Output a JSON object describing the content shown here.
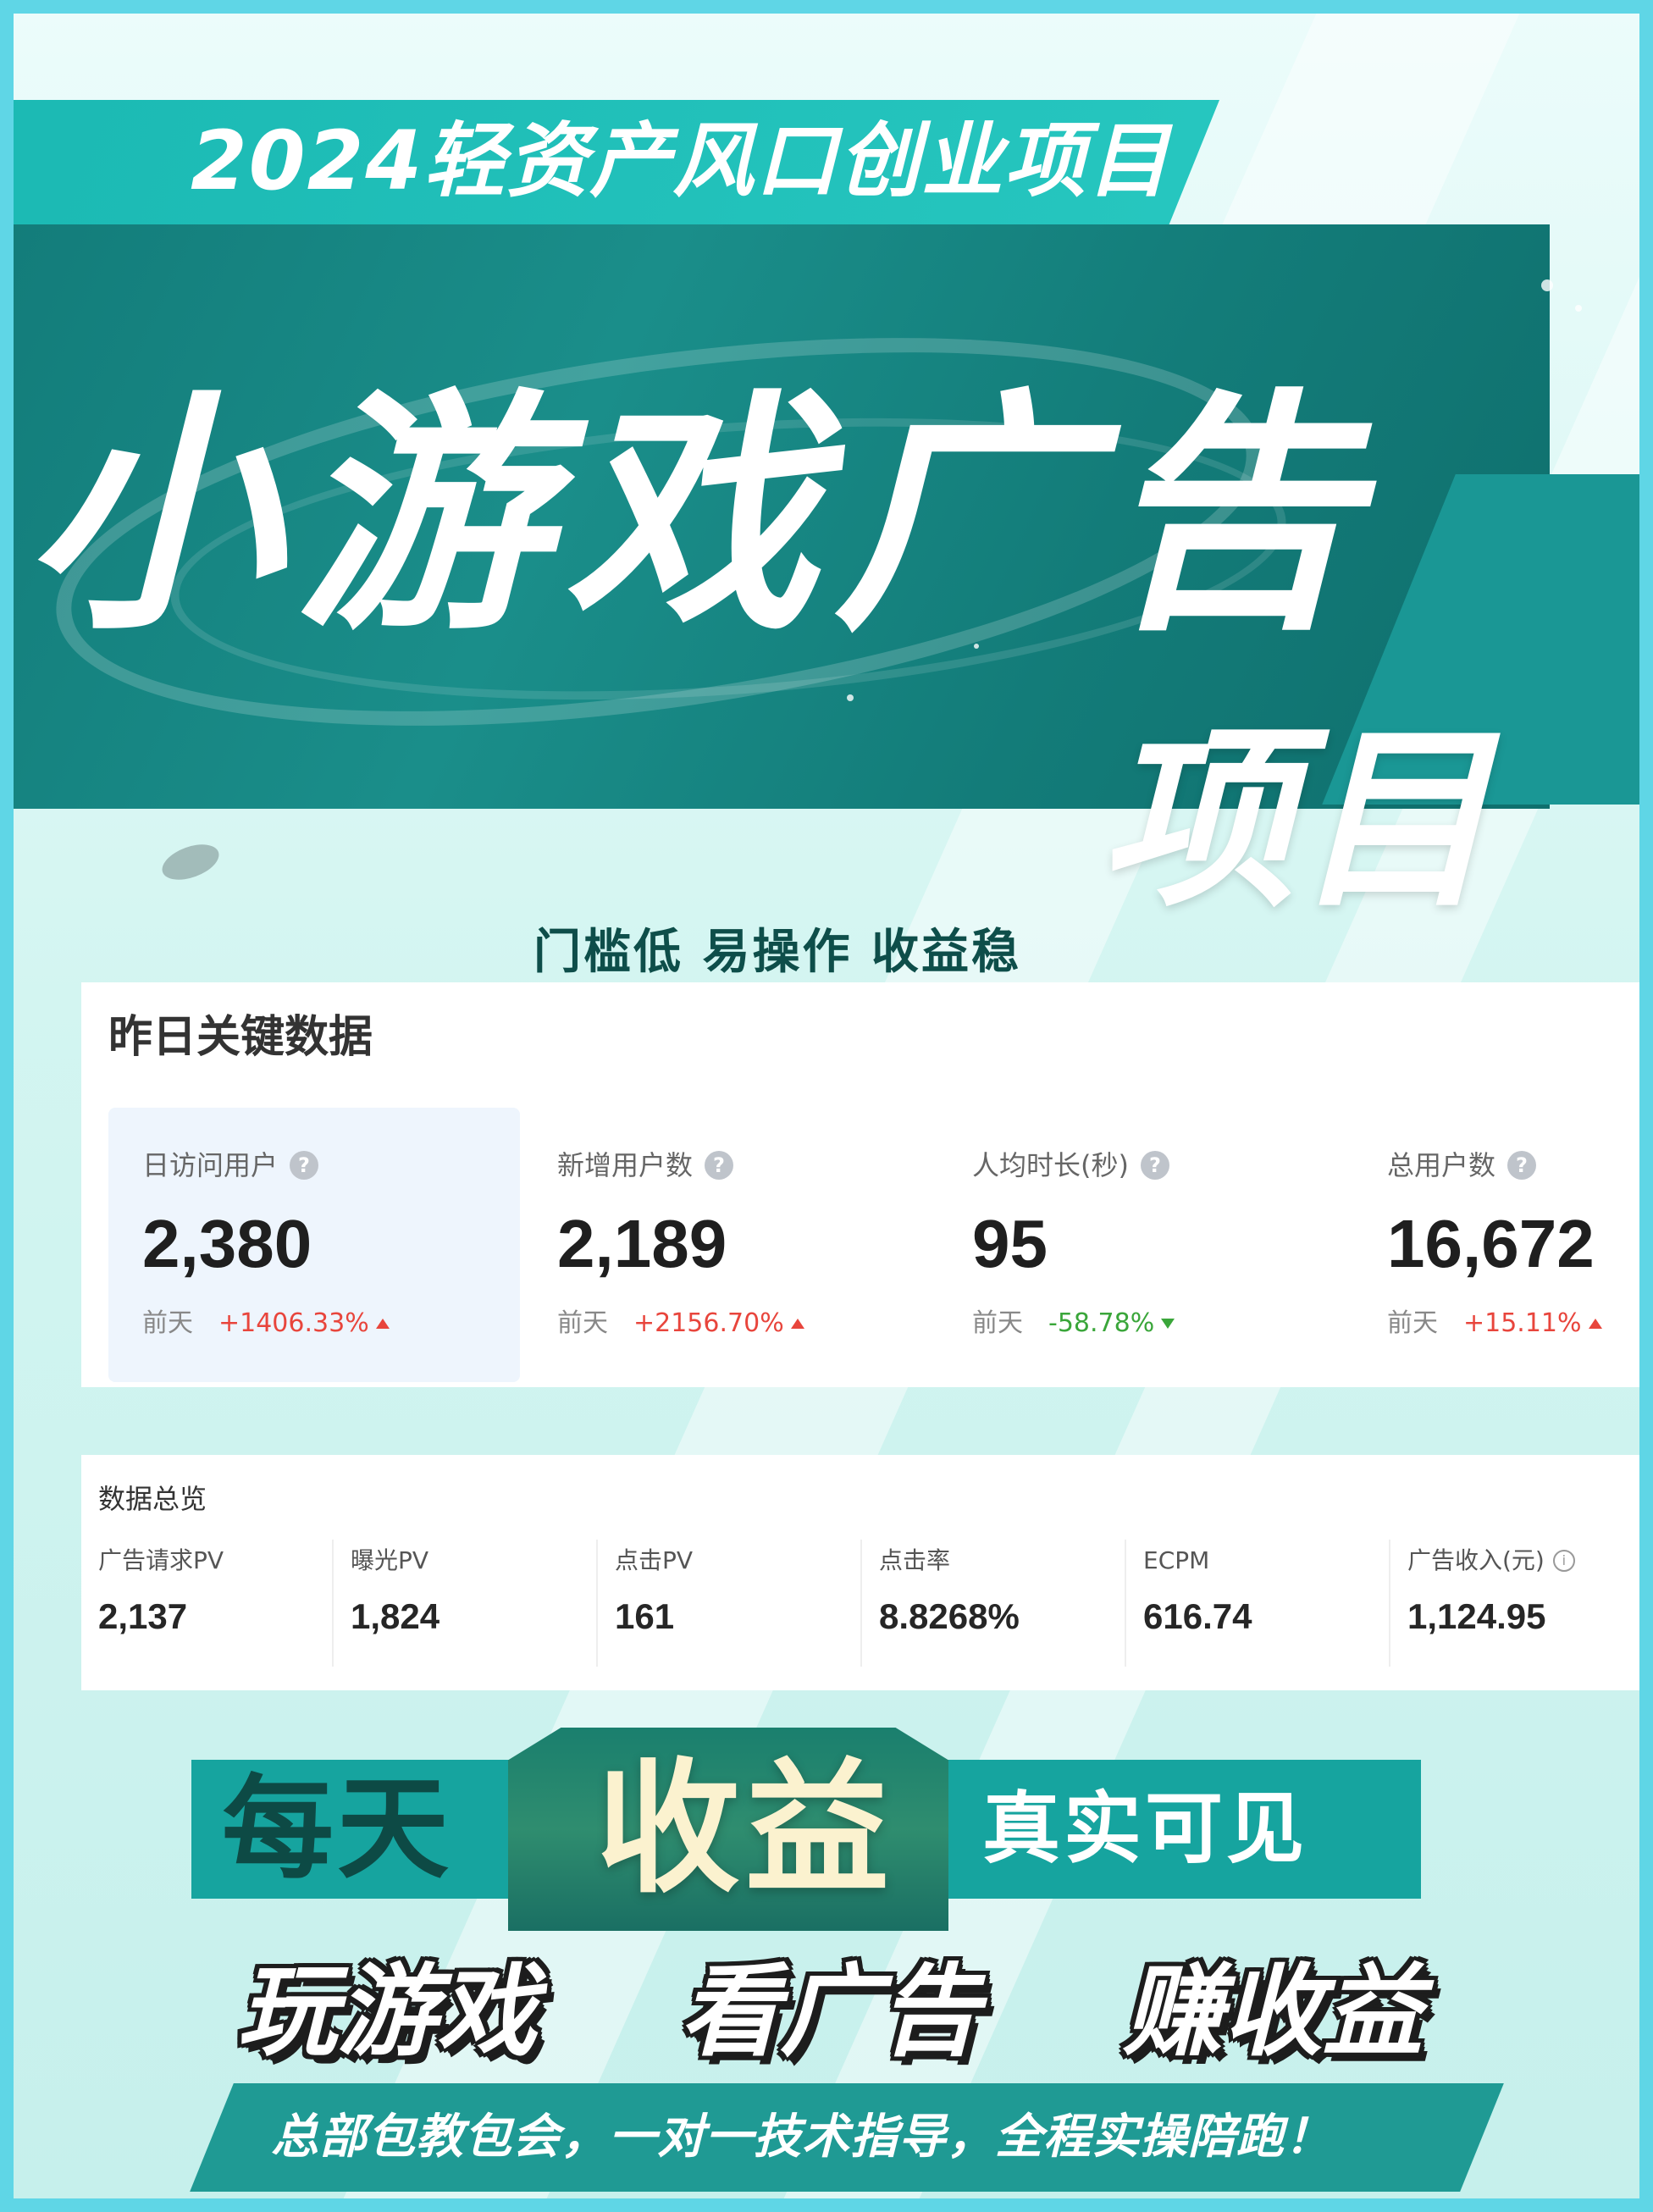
{
  "header": {
    "top_title": "2024轻资产风口创业项目",
    "hero_title": "小游戏广告",
    "hero_sub": "项目",
    "tagline": "门槛低  易操作  收益稳"
  },
  "key_data": {
    "title": "昨日关键数据",
    "prev_label": "前天",
    "metrics": [
      {
        "label": "日访问用户",
        "value": "2,380",
        "change": "+1406.33%",
        "direction": "up"
      },
      {
        "label": "新增用户数",
        "value": "2,189",
        "change": "+2156.70%",
        "direction": "up"
      },
      {
        "label": "人均时长(秒)",
        "value": "95",
        "change": "-58.78%",
        "direction": "down"
      },
      {
        "label": "总用户数",
        "value": "16,672",
        "change": "+15.11%",
        "direction": "up"
      }
    ]
  },
  "overview": {
    "title": "数据总览",
    "items": [
      {
        "label": "广告请求PV",
        "value": "2,137"
      },
      {
        "label": "曝光PV",
        "value": "1,824"
      },
      {
        "label": "点击PV",
        "value": "161"
      },
      {
        "label": "点击率",
        "value": "8.8268%"
      },
      {
        "label": "ECPM",
        "value": "616.74"
      },
      {
        "label": "广告收入(元)",
        "value": "1,124.95"
      }
    ]
  },
  "banner": {
    "left": "每天",
    "mid": "收益",
    "right": "真实可见"
  },
  "play_row": [
    "玩游戏",
    "看广告",
    "赚收益"
  ],
  "bottom_text": "总部包教包会，一对一技术指导，全程实操陪跑！",
  "colors": {
    "frame": "#5fd6e6",
    "teal_dark": "#127a78",
    "teal": "#1bb9b3",
    "up": "#e8453c",
    "down": "#3aa63a"
  }
}
